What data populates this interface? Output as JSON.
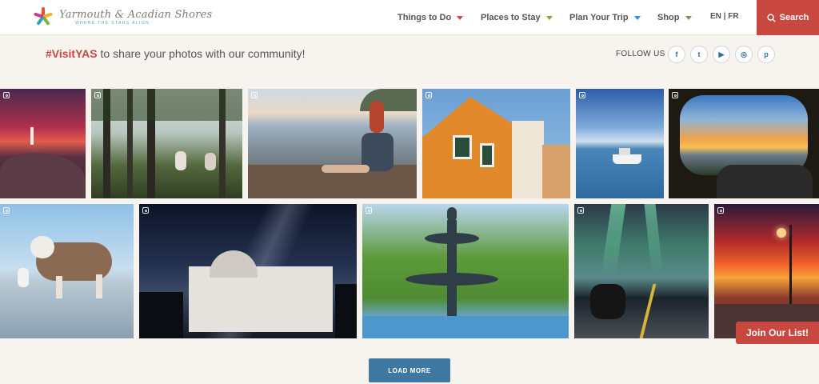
{
  "logo": {
    "title": "Yarmouth & Acadian Shores",
    "tagline": "WHERE THE STARS ALIGN"
  },
  "nav": {
    "items": [
      {
        "label": "Things to Do",
        "color": "#c8473e"
      },
      {
        "label": "Places to Stay",
        "color": "#8aa33a"
      },
      {
        "label": "Plan Your Trip",
        "color": "#3a8fc8"
      },
      {
        "label": "Shop",
        "color": "#8a8a5a"
      }
    ],
    "language": "EN | FR",
    "search_label": "Search"
  },
  "share": {
    "hashtag": "#VisitYAS",
    "text": " to share your photos with our community!"
  },
  "follow": {
    "label": "FOLLOW US",
    "icons": [
      {
        "icon": "facebook-icon",
        "glyph": "f"
      },
      {
        "icon": "twitter-icon",
        "glyph": "t"
      },
      {
        "icon": "youtube-icon",
        "glyph": "▶"
      },
      {
        "icon": "instagram-icon",
        "glyph": "◎"
      },
      {
        "icon": "pinterest-icon",
        "glyph": "p"
      }
    ]
  },
  "photos": [
    {
      "subject": "lighthouse at sunset"
    },
    {
      "subject": "forest picnic by lake"
    },
    {
      "subject": "woman on beach"
    },
    {
      "subject": "orange victorian house"
    },
    {
      "subject": "boat on calm water"
    },
    {
      "subject": "sunset from car"
    },
    {
      "subject": "dog on beach"
    },
    {
      "subject": "observatory under milky way"
    },
    {
      "subject": "park fountain"
    },
    {
      "subject": "northern lights over road"
    },
    {
      "subject": "street lamp sunset"
    }
  ],
  "load_more_label": "LOAD MORE",
  "join_label": "Join Our List!",
  "colors": {
    "accent": "#c8473e",
    "blue": "#3f78a0",
    "page_bg": "#f7f3ee"
  }
}
